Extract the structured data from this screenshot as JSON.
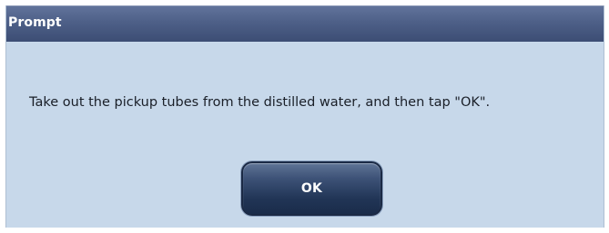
{
  "dialog": {
    "title": "Prompt",
    "message": "Take out the pickup tubes from the distilled water, and then tap \"OK\".",
    "ok_label": "OK"
  },
  "colors": {
    "titlebar": "#4e6088",
    "dialog_background": "#c7d8ea",
    "button": "#2a3e60",
    "text": "#1a1f28"
  }
}
